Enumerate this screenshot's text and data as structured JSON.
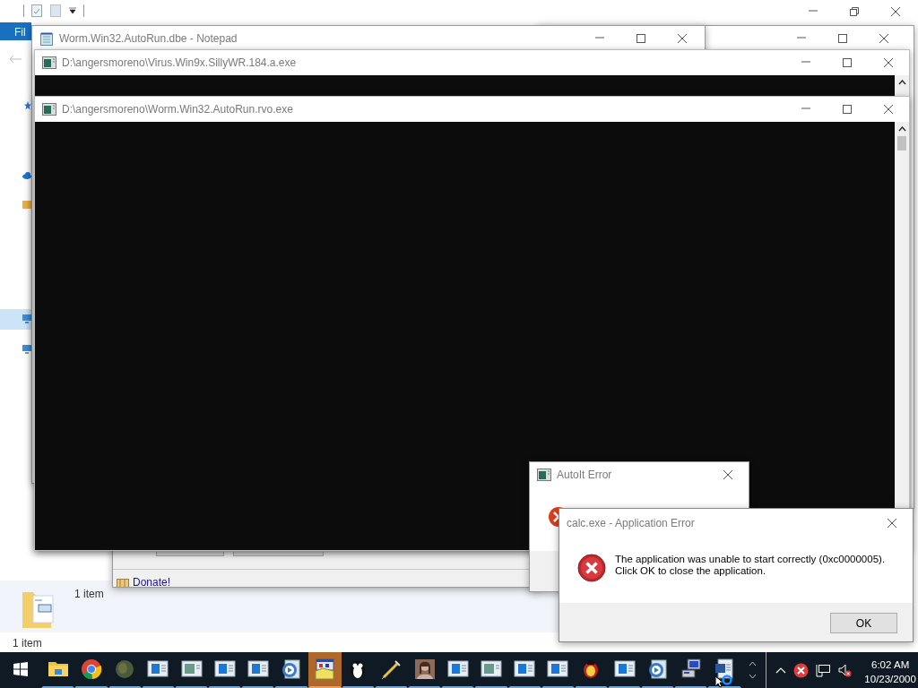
{
  "explorer": {
    "tab": "Fil",
    "details": "1 item",
    "status": "1 item"
  },
  "notepad": {
    "title": "Worm.Win32.AutoRun.dbe - Notepad"
  },
  "consoles": [
    {
      "title": "D:\\angersmoreno\\Virus.Win9x.SillyWR.184.a.exe"
    },
    {
      "title": "D:\\angersmoreno\\Worm.Win32.AutoRun.rvo.exe"
    }
  ],
  "autoit_window": {
    "link": "Donate!"
  },
  "autoit_error": {
    "title": "AutoIt Error"
  },
  "app_error": {
    "title": "calc.exe - Application Error",
    "message": "The application was unable to start correctly (0xc0000005).\nClick OK to close the application.",
    "button": "OK"
  },
  "taskbar": {
    "items": [
      {
        "kind": "folder",
        "selected": false
      },
      {
        "kind": "browser",
        "selected": false
      },
      {
        "kind": "globe",
        "selected": false
      },
      {
        "kind": "window",
        "selected": false
      },
      {
        "kind": "grey-window",
        "selected": false
      },
      {
        "kind": "window",
        "selected": false
      },
      {
        "kind": "window",
        "selected": false
      },
      {
        "kind": "media",
        "selected": false
      },
      {
        "kind": "installer",
        "selected": true
      },
      {
        "kind": "penguin",
        "selected": false
      },
      {
        "kind": "syringe",
        "selected": false
      },
      {
        "kind": "portrait",
        "selected": false
      },
      {
        "kind": "window",
        "selected": false
      },
      {
        "kind": "grey-window",
        "selected": false
      },
      {
        "kind": "window",
        "selected": false
      },
      {
        "kind": "window",
        "selected": false
      },
      {
        "kind": "red-penguin",
        "selected": false
      },
      {
        "kind": "window",
        "selected": false
      },
      {
        "kind": "media",
        "selected": false
      },
      {
        "kind": "computer",
        "selected": false
      },
      {
        "kind": "document",
        "selected": false
      }
    ],
    "clock": {
      "time": "6:02 AM",
      "date": "10/23/2000"
    }
  }
}
